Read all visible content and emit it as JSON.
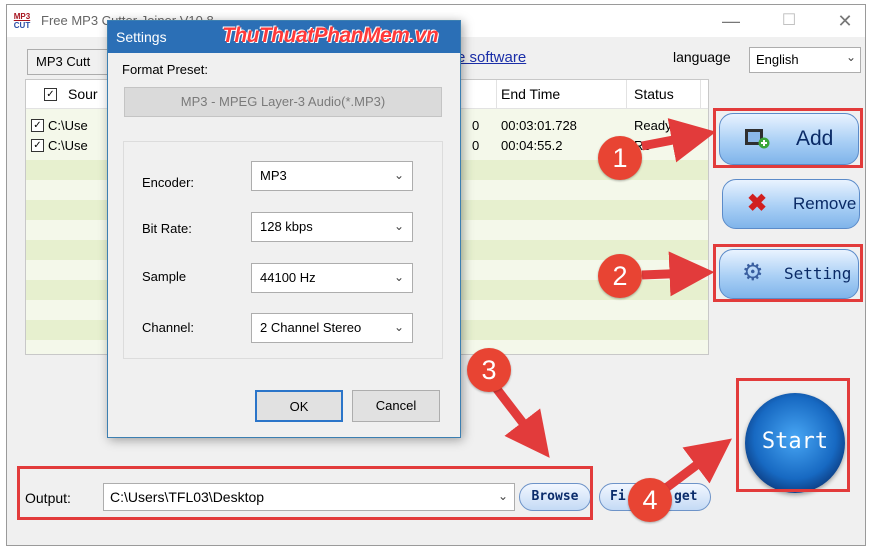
{
  "window": {
    "app_logo_top": "MP3",
    "app_logo_bottom": "CUT",
    "title": "Free MP3 Cutter Joiner V10.8"
  },
  "menubar": {
    "tab_label": "MP3 Cutt",
    "link_text": "e software",
    "language_label": "language",
    "language_value": "English"
  },
  "file_list": {
    "headers": {
      "source": "Sour",
      "end_time": "End Time",
      "status": "Status"
    },
    "rows": [
      {
        "path": "C:\\Use",
        "frag": "0",
        "end_time": "00:03:01.728",
        "status": "Ready"
      },
      {
        "path": "C:\\Use",
        "frag": "0",
        "end_time": "00:04:55.2",
        "status": "Re"
      }
    ]
  },
  "buttons": {
    "add": "Add",
    "remove": "Remove",
    "setting": "Setting",
    "start": "Start",
    "browse": "Browse",
    "find_target": "Fi",
    "find_target_tail": "get"
  },
  "output": {
    "label": "Output:",
    "path": "C:\\Users\\TFL03\\Desktop"
  },
  "dialog": {
    "title": "Settings",
    "watermark": "ThuThuatPhanMem.vn",
    "format_preset_label": "Format Preset:",
    "format_preset_value": "MP3 - MPEG Layer-3 Audio(*.MP3)",
    "fields": [
      {
        "label": "Encoder:",
        "value": "MP3"
      },
      {
        "label": "Bit Rate:",
        "value": "128 kbps"
      },
      {
        "label": "Sample",
        "value": "44100 Hz"
      },
      {
        "label": "Channel:",
        "value": "2 Channel Stereo"
      }
    ],
    "ok": "OK",
    "cancel": "Cancel"
  },
  "annotations": {
    "steps": [
      "1",
      "2",
      "3",
      "4"
    ],
    "color": "#e23b3b"
  }
}
